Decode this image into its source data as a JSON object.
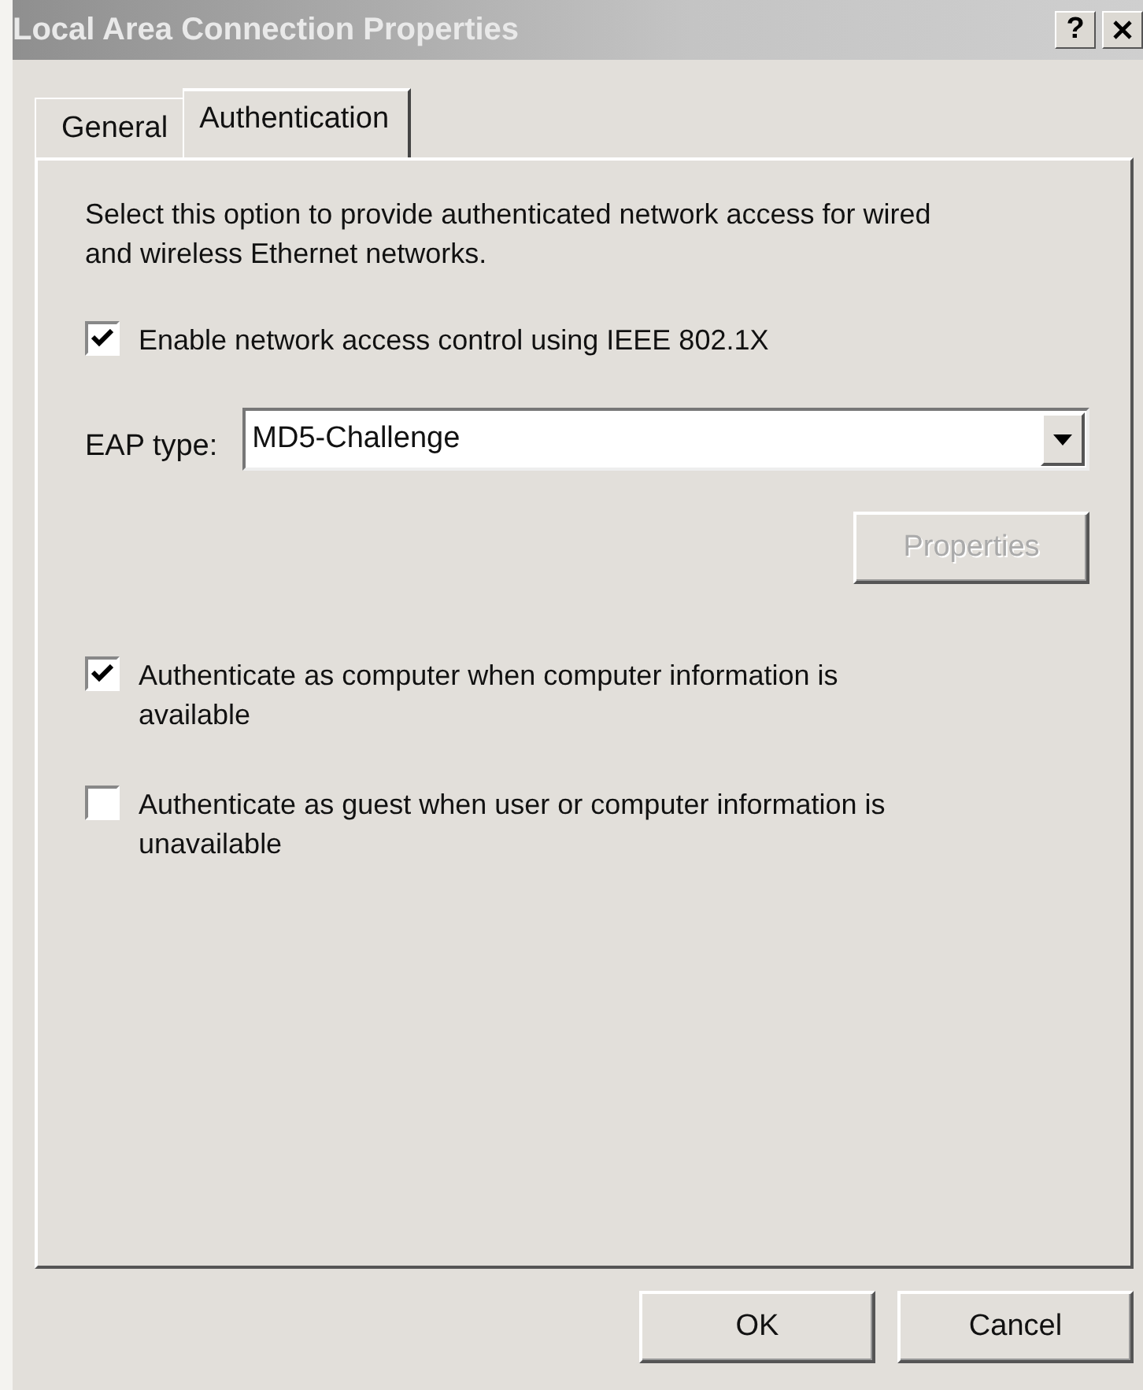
{
  "window": {
    "title": "Local Area Connection Properties",
    "help_button": "?"
  },
  "tabs": [
    {
      "label": "General",
      "selected": false
    },
    {
      "label": "Authentication",
      "selected": true
    }
  ],
  "description": "Select this option to provide authenticated network access for wired and wireless Ethernet networks.",
  "enable_option": {
    "label": "Enable network access control using IEEE 802.1X",
    "checked": true
  },
  "eap_type": {
    "label": "EAP type:",
    "value": "MD5-Challenge"
  },
  "properties_button": {
    "label": "Properties",
    "disabled": true
  },
  "options": [
    {
      "label": "Authenticate as computer when computer information is available",
      "checked": true
    },
    {
      "label": "Authenticate as guest when user or computer information is unavailable",
      "checked": false
    }
  ],
  "buttons": [
    "OK",
    "Cancel"
  ]
}
